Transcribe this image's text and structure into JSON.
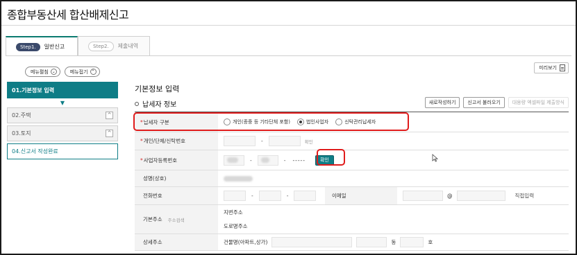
{
  "page": {
    "title": "종합부동산세 합산배제신고"
  },
  "tabs": [
    {
      "step": "Step1.",
      "label": "일반신고",
      "active": true
    },
    {
      "step": "Step2.",
      "label": "제출내역",
      "active": false
    }
  ],
  "toolbar": {
    "preview_label": "미리보기"
  },
  "sidebar": {
    "expand_label": "메뉴펼침",
    "collapse_label": "메뉴접기",
    "items": [
      {
        "label": "01.기본정보 입력",
        "state": "active"
      },
      {
        "label": "02.주택",
        "state": "collapsed"
      },
      {
        "label": "03.토지",
        "state": "collapsed"
      },
      {
        "label": "04.신고서 작성완료",
        "state": "done"
      }
    ]
  },
  "main": {
    "section_title": "기본정보 입력",
    "subsection_title": "납세자 정보",
    "actions": {
      "new": "새로작성하기",
      "load": "신고서 불러오기",
      "bulk": "대용량 엑셀파일 제출방식"
    }
  },
  "form": {
    "taxpayer_type": {
      "label": "납세자 구분",
      "options": [
        {
          "label": "개인(종중 등 기타단체 포함)",
          "selected": false
        },
        {
          "label": "법인사업자",
          "selected": true
        },
        {
          "label": "신탁관리납세자",
          "selected": false
        }
      ]
    },
    "id_number": {
      "label": "개인/단체/신탁번호",
      "confirm": "확인"
    },
    "biz_number": {
      "label": "사업자등록번호",
      "masked": "-----",
      "confirm": "확인"
    },
    "name": {
      "label": "성명(상호)"
    },
    "phone": {
      "label": "전화번호"
    },
    "email": {
      "label": "이메일",
      "at": "@",
      "direct": "직접입력"
    },
    "address": {
      "label": "기본주소",
      "search": "주소검색",
      "jibun": "지번주소",
      "road": "도로명주소"
    },
    "detail_address": {
      "label": "상세주소",
      "building": "건물명(아파트,상가)",
      "dong": "동",
      "ho": "호"
    }
  },
  "colors": {
    "accent": "#0e7d86",
    "highlight": "#e01b1b",
    "required": "#d62b2b"
  }
}
